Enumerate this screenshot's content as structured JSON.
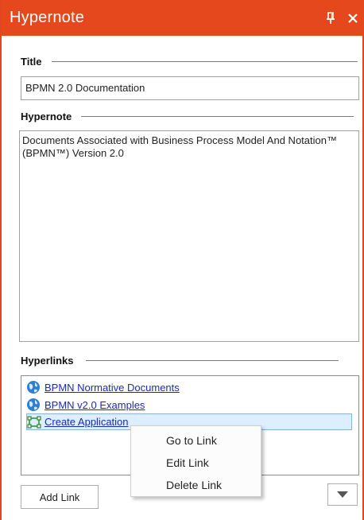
{
  "window": {
    "title": "Hypernote"
  },
  "title_section": {
    "label": "Title",
    "value": "BPMN 2.0 Documentation"
  },
  "hypernote_section": {
    "label": "Hypernote",
    "text": "Documents Associated with Business Process Model And Notation™\n(BPMN™) Version 2.0"
  },
  "hyperlinks_section": {
    "label": "Hyperlinks",
    "items": [
      {
        "label": "BPMN Normative Documents",
        "icon": "globe-icon"
      },
      {
        "label": "BPMN v2.0 Examples",
        "icon": "globe-icon"
      },
      {
        "label": "Create Application",
        "icon": "diagram-icon"
      }
    ]
  },
  "context_menu": {
    "items": [
      {
        "label": "Go to Link"
      },
      {
        "label": "Edit Link"
      },
      {
        "label": "Delete Link"
      }
    ]
  },
  "buttons": {
    "add_link": "Add Link"
  },
  "colors": {
    "accent": "#e4481c",
    "link": "#1a2bb8",
    "selection": "#ddeeff"
  }
}
